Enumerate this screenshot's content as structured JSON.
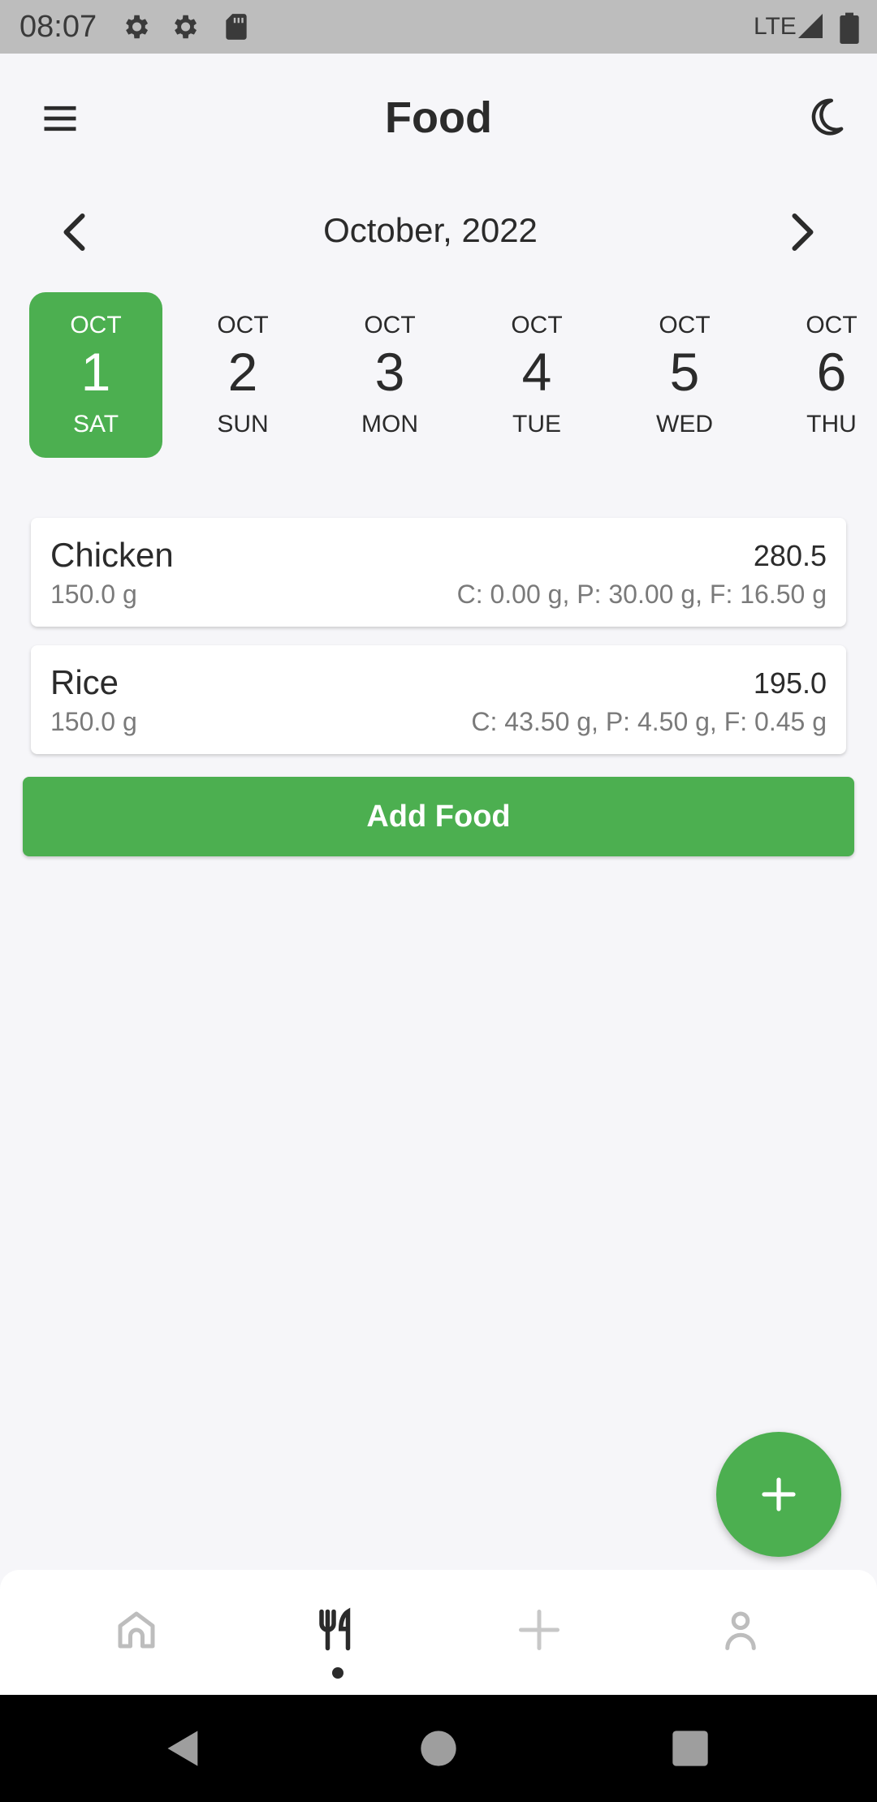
{
  "status_bar": {
    "time": "08:07",
    "network": "LTE",
    "icons": [
      "settings-icon",
      "settings-icon",
      "sd-card-icon",
      "signal-icon",
      "battery-icon"
    ]
  },
  "app_bar": {
    "title": "Food",
    "menu_icon": "hamburger-menu-icon",
    "theme_icon": "moon-icon"
  },
  "calendar": {
    "month_label": "October, 2022",
    "days": [
      {
        "month": "OCT",
        "day": "1",
        "weekday": "SAT",
        "selected": true
      },
      {
        "month": "OCT",
        "day": "2",
        "weekday": "SUN",
        "selected": false
      },
      {
        "month": "OCT",
        "day": "3",
        "weekday": "MON",
        "selected": false
      },
      {
        "month": "OCT",
        "day": "4",
        "weekday": "TUE",
        "selected": false
      },
      {
        "month": "OCT",
        "day": "5",
        "weekday": "WED",
        "selected": false
      },
      {
        "month": "OCT",
        "day": "6",
        "weekday": "THU",
        "selected": false
      }
    ]
  },
  "foods": [
    {
      "name": "Chicken",
      "weight": "150.0 g",
      "calories": "280.5",
      "macros": "C: 0.00 g, P: 30.00 g, F: 16.50 g"
    },
    {
      "name": "Rice",
      "weight": "150.0 g",
      "calories": "195.0",
      "macros": "C: 43.50 g, P: 4.50 g, F: 0.45 g"
    }
  ],
  "add_food_label": "Add Food",
  "bottom_nav": {
    "items": [
      "home-icon",
      "food-icon",
      "add-icon",
      "profile-icon"
    ],
    "active": "food-icon"
  },
  "colors": {
    "accent": "#4caf50",
    "background": "#f6f6f9",
    "text": "#2b2b2b",
    "muted": "#7a7a7a"
  }
}
